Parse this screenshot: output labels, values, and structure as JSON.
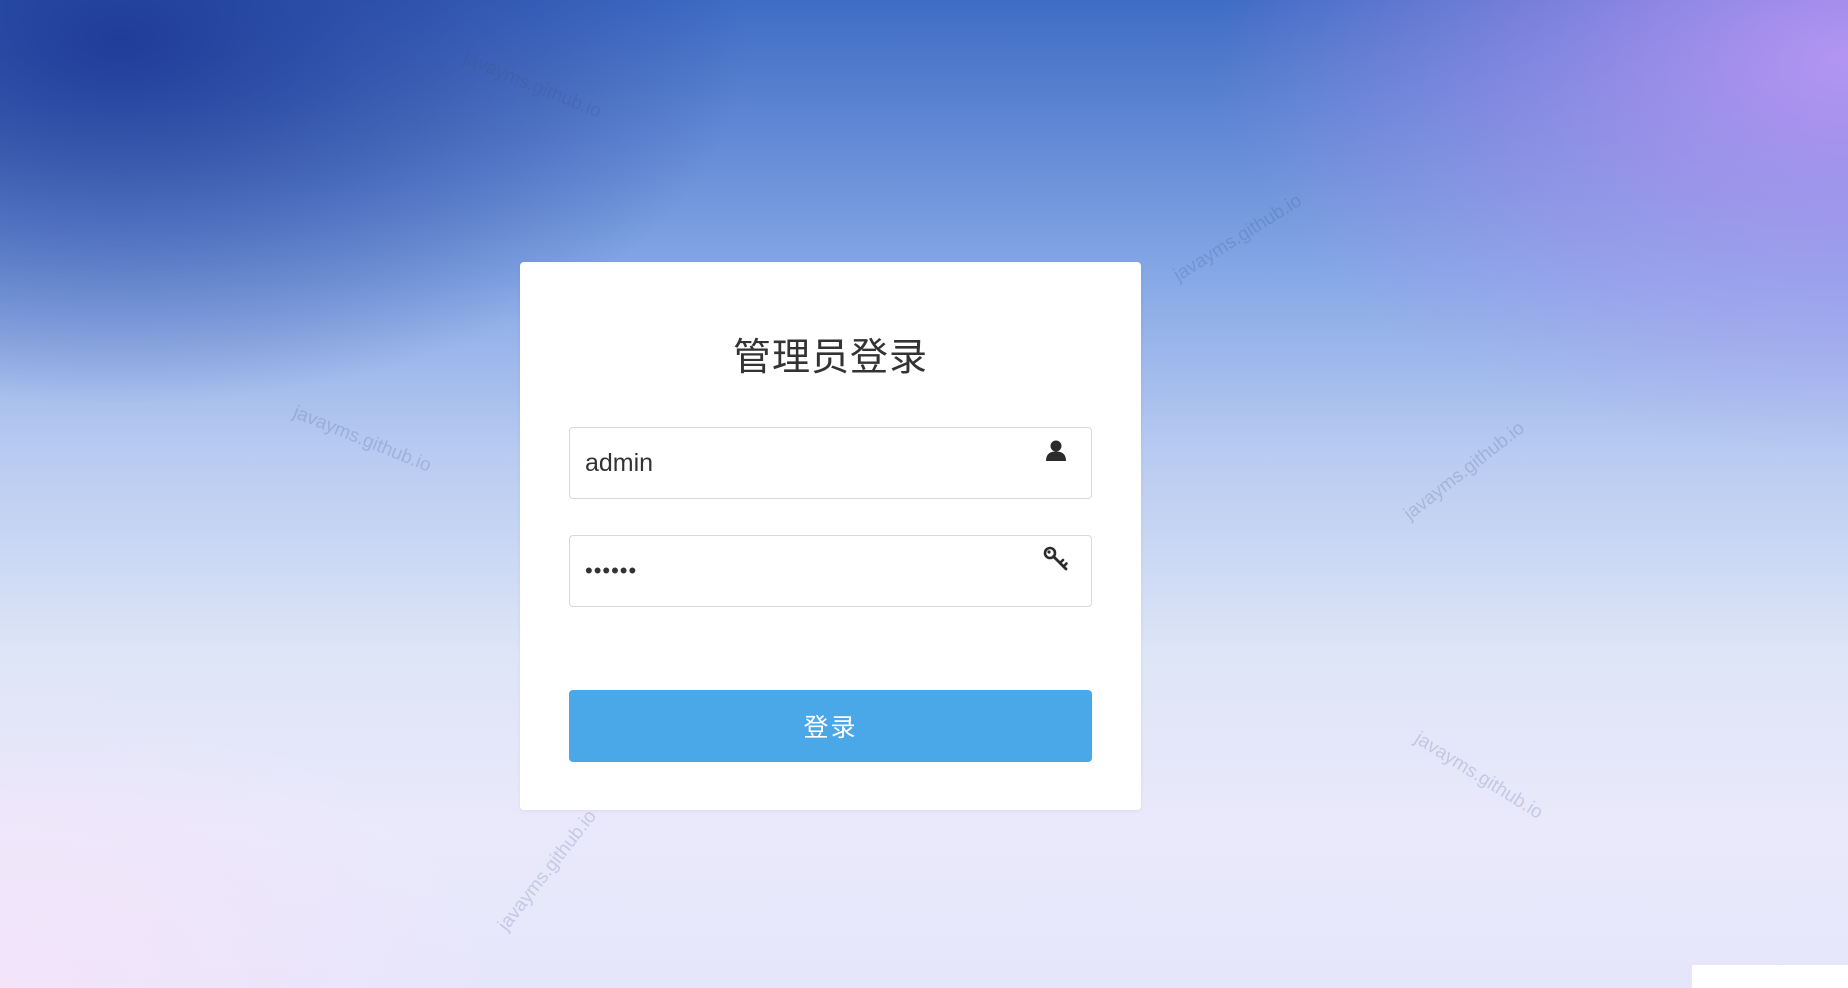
{
  "page": {
    "watermark_text": "javayms.github.io"
  },
  "login": {
    "title": "管理员登录",
    "username": {
      "value": "admin",
      "icon": "user-icon"
    },
    "password": {
      "value": "••••••",
      "icon": "key-icon"
    },
    "submit_label": "登录"
  },
  "colors": {
    "primary_button": "#4aa7e8",
    "card_background": "#ffffff",
    "title_text": "#333333"
  }
}
